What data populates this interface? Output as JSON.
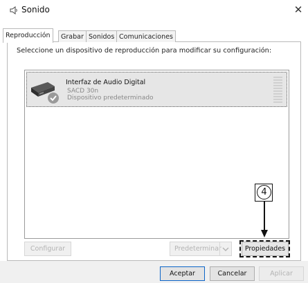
{
  "window": {
    "title": "Sonido",
    "close_glyph": "✕",
    "icon": "speaker-icon"
  },
  "tabs": [
    {
      "label": "Reproducción",
      "active": true
    },
    {
      "label": "Grabar",
      "active": false
    },
    {
      "label": "Sonidos",
      "active": false
    },
    {
      "label": "Comunicaciones",
      "active": false
    }
  ],
  "instruction": "Seleccione un dispositivo de reproducción para modificar su configuración:",
  "device": {
    "name": "Interfaz de Audio Digital",
    "model": "SACD 30n",
    "status": "Dispositivo predeterminado",
    "icon": "audio-device-icon",
    "badge_icon": "default-check-icon"
  },
  "buttons": {
    "configure": "Configurar",
    "set_default": "Predeterminar",
    "properties": "Propiedades",
    "ok": "Aceptar",
    "cancel": "Cancelar",
    "apply": "Aplicar"
  },
  "annotation": {
    "step_number": "4"
  },
  "colors": {
    "selected_bg": "#e6e6e6",
    "check_badge": "#9a9a9a",
    "disabled_text": "#b3b3b3"
  }
}
